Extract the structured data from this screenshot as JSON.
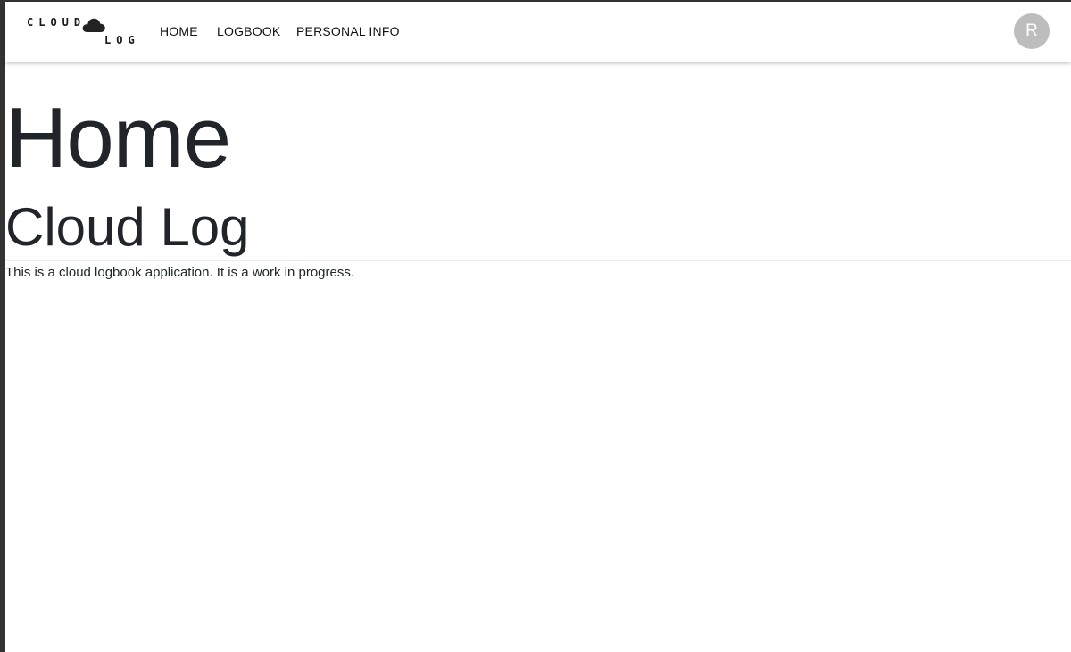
{
  "logo": {
    "line1": "CLOUD",
    "line2": "LOG",
    "icon": "cloud-icon"
  },
  "nav": {
    "items": [
      {
        "label": "HOME"
      },
      {
        "label": "LOGBOOK"
      },
      {
        "label": "PERSONAL INFO"
      }
    ]
  },
  "avatar": {
    "initial": "R",
    "color": "#bdbdbd"
  },
  "main": {
    "title": "Home",
    "subtitle": "Cloud Log",
    "description": "This is a cloud logbook application. It is a work in progress."
  }
}
